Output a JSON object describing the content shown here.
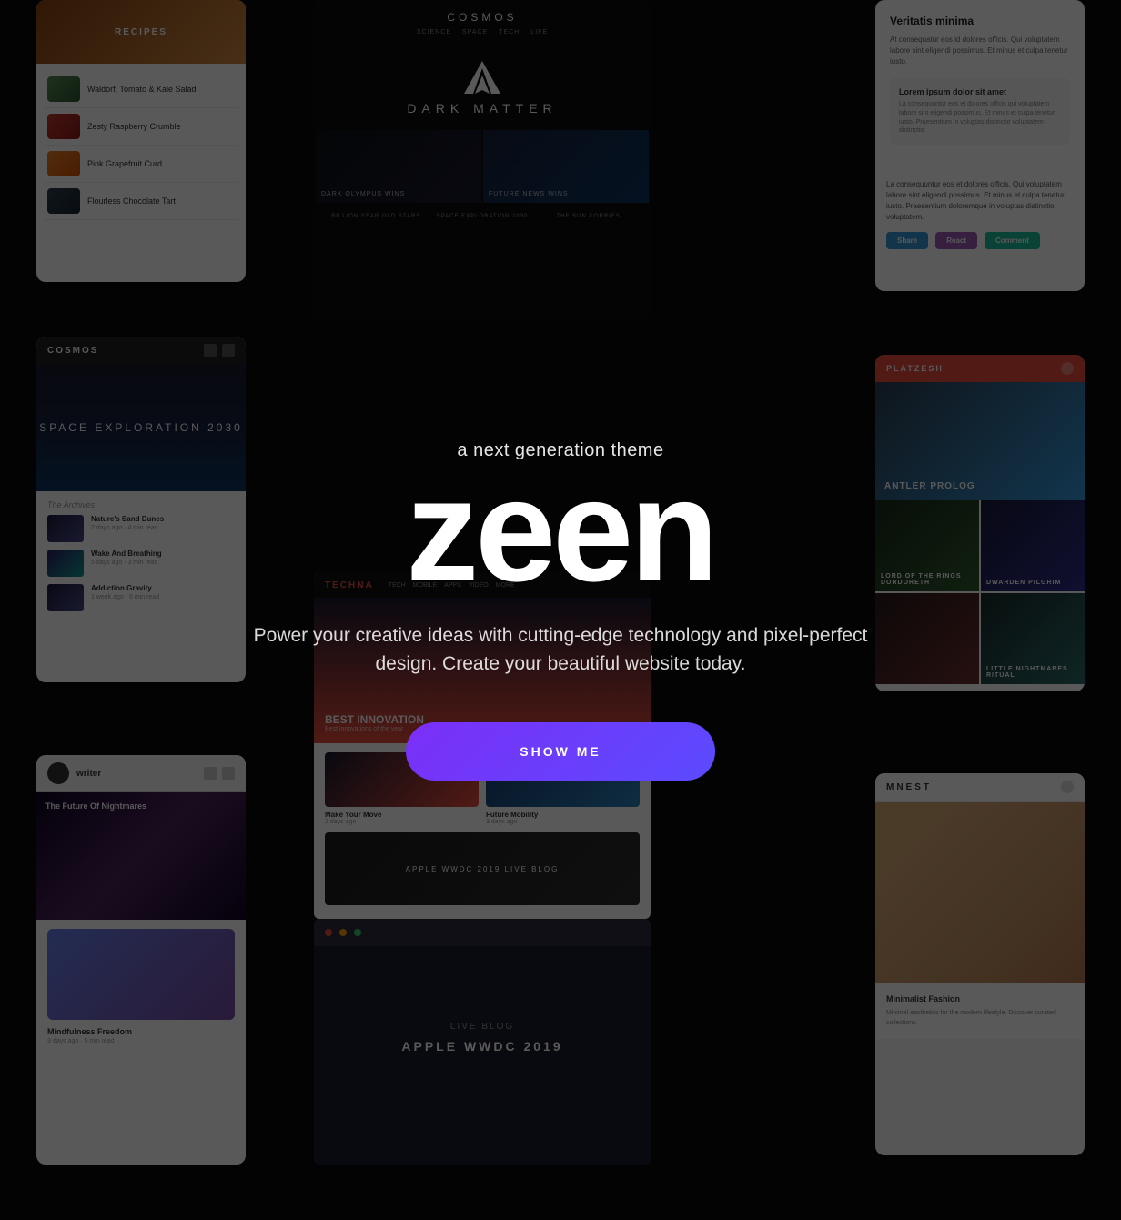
{
  "hero": {
    "tagline": "a next generation theme",
    "title": "zeen",
    "description": "Power your creative ideas with cutting-edge technology and pixel-perfect design. Create your beautiful website today.",
    "cta_label": "SHOW ME"
  },
  "screenshots": {
    "food_app": {
      "header": "RECIPES",
      "items": [
        {
          "label": "Waldorf, Tomato & Kale Salad"
        },
        {
          "label": "Zesty Raspberry Crumble"
        },
        {
          "label": "Pink Grapefruit Curd"
        },
        {
          "label": "Flourless Chocolate Tart"
        }
      ]
    },
    "cosmos_app": {
      "logo": "COSMOS",
      "hero_title": "SPACE EXPLORATION 2030",
      "articles": [
        {
          "title": "Nature's Sand Dunes"
        },
        {
          "title": "Wake And Breathing"
        },
        {
          "title": "Addiction Gravity"
        }
      ]
    },
    "dark_matter": {
      "logo": "COSMOS",
      "title": "DARK MATTER",
      "grid_items": [
        {
          "label": "DARK OLYMPUS WINS"
        },
        {
          "label": "FUTURE NEWS WINS"
        }
      ],
      "bottom_labels": [
        "BILLION YEAR OLD STARS",
        "SPACE EXPLORATION 2030",
        "THE SUN CORRIES"
      ]
    },
    "veritatis": {
      "title": "Veritatis minima",
      "text": "At consequatur eos id dolores officis. Qui voluptatem labore sint eligendi possimus. Et minus et culpa tenetur iusto."
    },
    "social_card": {
      "text": "La consequuntur eos et dolores officis. Qui voluptatem labore sint eligendi possimus. Et minus et culpa tenetur iusto. Praesentium doloremque in voluptas distinctio voluptatem.",
      "buttons": [
        "Share",
        "React",
        "Comment"
      ]
    },
    "platzesh": {
      "logo": "PLATZESH",
      "hero_title": "ANTLER PROLOG",
      "grid_items": [
        {
          "label": "LORD OF THE RINGS DORDORETH"
        },
        {
          "label": "DWARDEN PILGRIM"
        },
        {
          "label": "LITTLE NIGHTMARES RITUAL"
        }
      ]
    },
    "techna": {
      "logo": "TECHNA",
      "hero_title": "BEST INNOVATION",
      "apple_event": "APPLE WWDC 2019 LIVE BLOG"
    },
    "writer": {
      "name": "writer",
      "featured_title": "The Future Of Nightmares",
      "bottom_title": "Mindfulness Freedom"
    },
    "mnest": {
      "logo": "MNEST",
      "title": "Minimalist Fashion"
    }
  },
  "colors": {
    "background": "#0a0a0a",
    "cta_gradient_start": "#7b2ff7",
    "cta_gradient_end": "#5b4bff",
    "text_primary": "#ffffff",
    "text_muted": "rgba(255,255,255,0.85)"
  }
}
